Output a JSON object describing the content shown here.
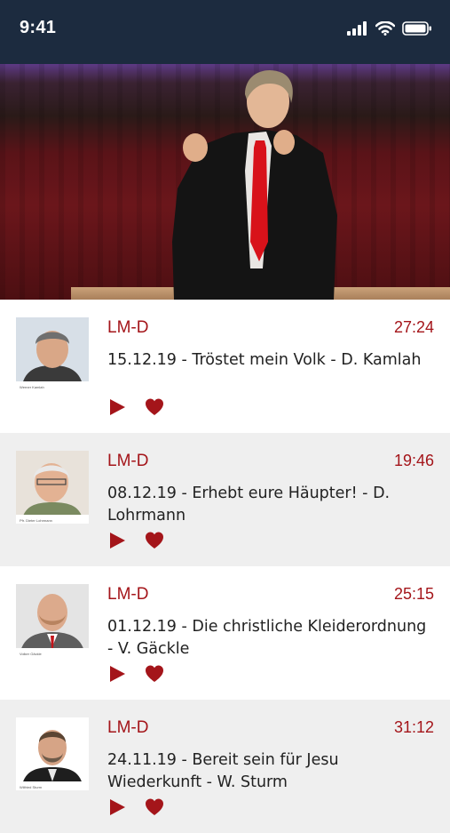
{
  "status_bar": {
    "time": "9:41"
  },
  "colors": {
    "accent": "#a4151a",
    "header": "#1c2b3f"
  },
  "sermons": [
    {
      "channel": "LM-D",
      "duration": "27:24",
      "title": "15.12.19 - Tröstet mein Volk - D. Kamlah",
      "thumb_caption": "Werner Kamlah"
    },
    {
      "channel": "LM-D",
      "duration": "19:46",
      "title": "08.12.19 - Erhebt eure Häupter! - D. Lohrmann",
      "thumb_caption": "Pfr. Dieter Lohrmann"
    },
    {
      "channel": "LM-D",
      "duration": "25:15",
      "title": "01.12.19 - Die christliche Kleiderordnung - V. Gäckle",
      "thumb_caption": "Volker Gäckle"
    },
    {
      "channel": "LM-D",
      "duration": "31:12",
      "title": "24.11.19 - Bereit sein für Jesu Wiederkunft - W. Sturm",
      "thumb_caption": "Wilfried Sturm"
    }
  ],
  "icons": {
    "play": "play-icon",
    "favorite": "heart-icon"
  }
}
